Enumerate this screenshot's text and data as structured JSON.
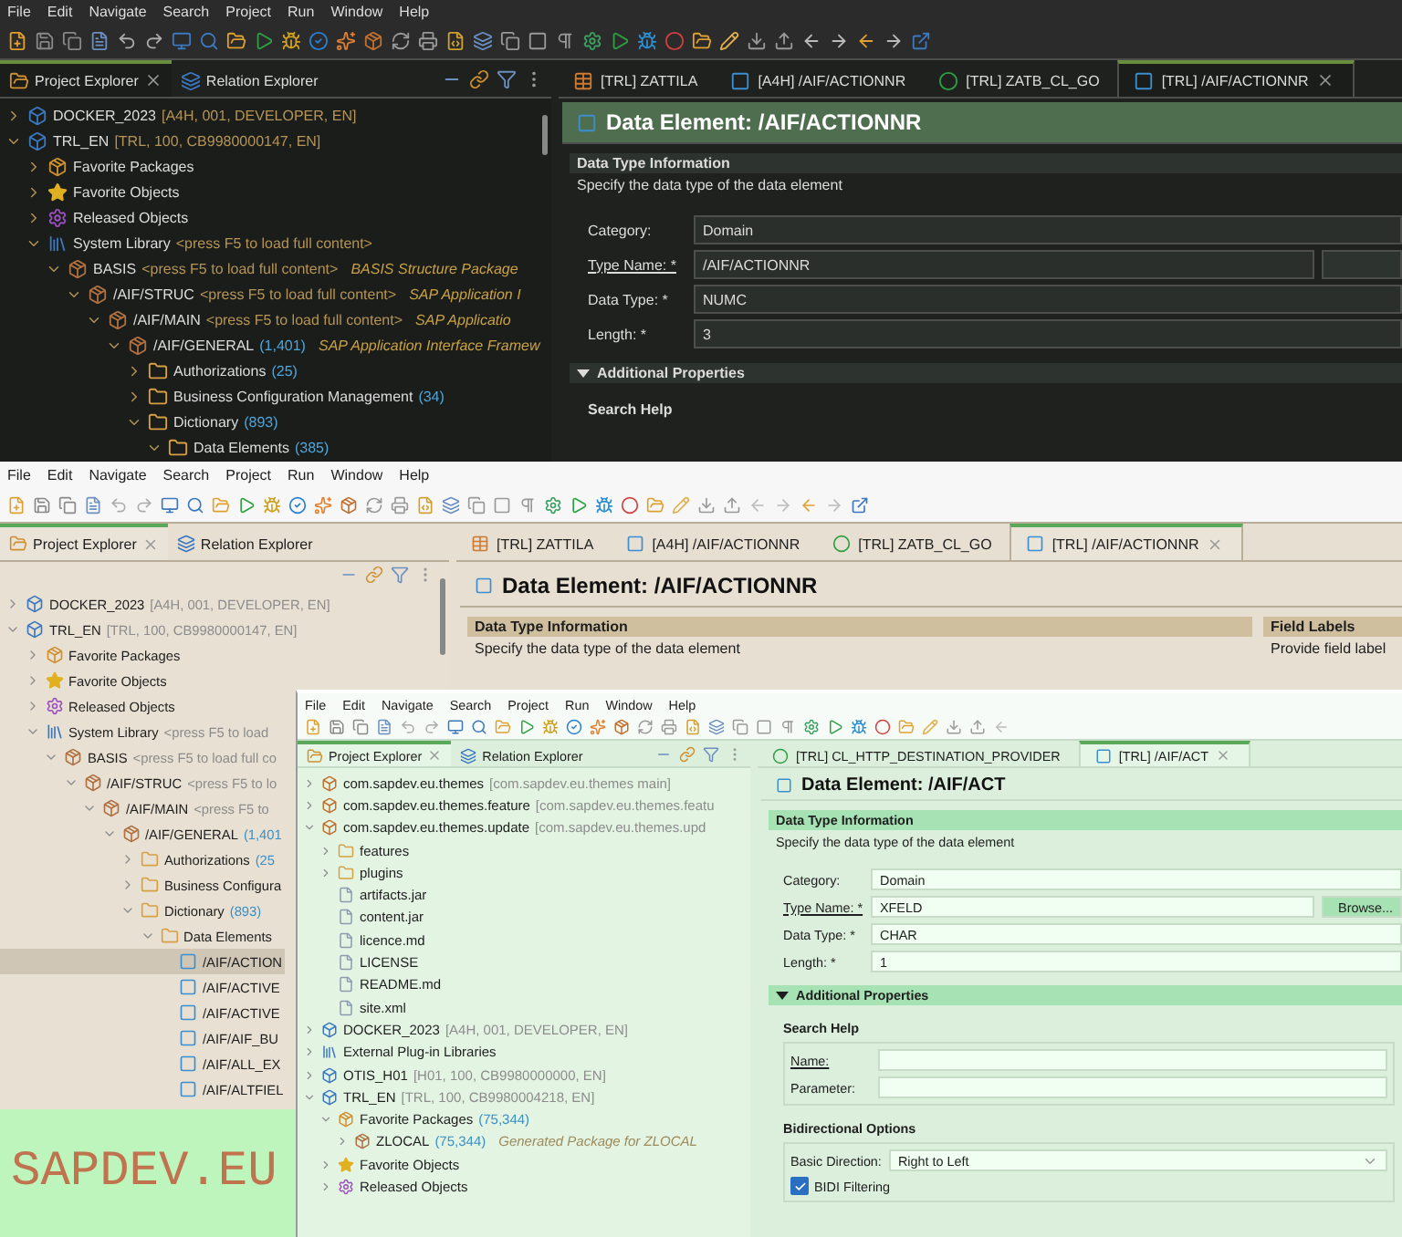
{
  "windows": [
    {
      "kind": "dark",
      "menu": [
        "File",
        "Edit",
        "Navigate",
        "Search",
        "Project",
        "Run",
        "Window",
        "Help"
      ],
      "views": [
        {
          "label": "Project Explorer",
          "selected": true
        },
        {
          "label": "Relation Explorer",
          "selected": false
        }
      ],
      "tree": [
        {
          "kind": "project",
          "label": "DOCKER_2023",
          "decoration": "[A4H, 001, DEVELOPER, EN]",
          "expanded": false
        },
        {
          "kind": "project",
          "label": "TRL_EN",
          "decoration": "[TRL, 100, CB9980000147, EN]",
          "expanded": true,
          "children": [
            {
              "kind": "favorites",
              "label": "Favorite Packages",
              "expanded": false
            },
            {
              "kind": "star",
              "label": "Favorite Objects",
              "expanded": false
            },
            {
              "kind": "released",
              "label": "Released Objects",
              "expanded": false
            },
            {
              "kind": "library",
              "label": "System Library",
              "decoration": "<press F5 to load full content>",
              "expanded": true,
              "children": [
                {
                  "kind": "package",
                  "label": "BASIS",
                  "decoration": "<press F5 to load full content>",
                  "note": "BASIS Structure Package",
                  "expanded": true,
                  "children": [
                    {
                      "kind": "package",
                      "label": "/AIF/STRUC",
                      "decoration": "<press F5 to load full content>",
                      "note": "SAP Application I",
                      "expanded": true,
                      "children": [
                        {
                          "kind": "package",
                          "label": "/AIF/MAIN",
                          "decoration": "<press F5 to load full content>",
                          "note": "SAP Applicatio",
                          "expanded": true,
                          "children": [
                            {
                              "kind": "package",
                              "label": "/AIF/GENERAL",
                              "count": "(1,401)",
                              "note": "SAP Application Interface Framew",
                              "expanded": true,
                              "children": [
                                {
                                  "kind": "group",
                                  "label": "Authorizations",
                                  "count": "(25)",
                                  "expanded": false
                                },
                                {
                                  "kind": "group",
                                  "label": "Business Configuration Management",
                                  "count": "(34)",
                                  "expanded": false
                                },
                                {
                                  "kind": "group",
                                  "label": "Dictionary",
                                  "count": "(893)",
                                  "expanded": true,
                                  "children": [
                                    {
                                      "kind": "folder",
                                      "label": "Data Elements",
                                      "count": "(385)",
                                      "expanded": true
                                    }
                                  ]
                                }
                              ]
                            }
                          ]
                        }
                      ]
                    }
                  ]
                }
              ]
            }
          ]
        }
      ],
      "editor_tabs": [
        {
          "kind": "table",
          "label": "[TRL] ZATTILA",
          "selected": false
        },
        {
          "kind": "element",
          "label": "[A4H] /AIF/ACTIONNR",
          "selected": false
        },
        {
          "kind": "class",
          "label": "[TRL] ZATB_CL_GO",
          "selected": false
        },
        {
          "kind": "element",
          "label": "[TRL] /AIF/ACTIONNR",
          "selected": true
        }
      ],
      "editor": {
        "title": "Data Element: /AIF/ACTIONNR",
        "sections": [
          {
            "title": "Data Type Information",
            "description": "Specify the data type of the data element",
            "fields": [
              {
                "kind": "text",
                "label": "Category:",
                "value": "Domain"
              },
              {
                "kind": "text",
                "label": "Type Name: *",
                "value": "/AIF/ACTIONNR",
                "link": true,
                "browse": true
              },
              {
                "kind": "text",
                "label": "Data Type: *",
                "value": "NUMC"
              },
              {
                "kind": "text",
                "label": "Length: *",
                "value": "3"
              }
            ]
          },
          {
            "title": "Additional Properties",
            "expanded": true,
            "groups": [
              {
                "title": "Search Help"
              }
            ]
          }
        ]
      }
    },
    {
      "kind": "classic",
      "menu": [
        "File",
        "Edit",
        "Navigate",
        "Search",
        "Project",
        "Run",
        "Window",
        "Help"
      ],
      "views": [
        {
          "label": "Project Explorer",
          "selected": true
        },
        {
          "label": "Relation Explorer",
          "selected": false
        }
      ],
      "tree": [
        {
          "kind": "project",
          "label": "DOCKER_2023",
          "decoration": "[A4H, 001, DEVELOPER, EN]",
          "expanded": false,
          "selected": false
        },
        {
          "kind": "project",
          "label": "TRL_EN",
          "decoration": "[TRL, 100, CB9980000147, EN]",
          "expanded": true,
          "selected": false,
          "children": [
            {
              "kind": "favorites",
              "label": "Favorite Packages",
              "expanded": false,
              "selected": false
            },
            {
              "kind": "star",
              "label": "Favorite Objects",
              "expanded": false,
              "selected": false
            },
            {
              "kind": "released",
              "label": "Released Objects",
              "expanded": false,
              "selected": false
            },
            {
              "kind": "library",
              "label": "System Library",
              "decoration": "<press F5 to load",
              "expanded": true,
              "selected": false,
              "children": [
                {
                  "kind": "package",
                  "label": "BASIS",
                  "decoration": "<press F5 to load full co",
                  "expanded": true,
                  "selected": false,
                  "children": [
                    {
                      "kind": "package",
                      "label": "/AIF/STRUC",
                      "decoration": "<press F5 to lo",
                      "expanded": true,
                      "selected": false,
                      "children": [
                        {
                          "kind": "package",
                          "label": "/AIF/MAIN",
                          "decoration": "<press F5 to",
                          "expanded": true,
                          "selected": false,
                          "children": [
                            {
                              "kind": "package",
                              "label": "/AIF/GENERAL",
                              "count": "(1,401",
                              "expanded": true,
                              "selected": false,
                              "children": [
                                {
                                  "kind": "group",
                                  "label": "Authorizations",
                                  "count": "(25",
                                  "expanded": false,
                                  "selected": false
                                },
                                {
                                  "kind": "group",
                                  "label": "Business Configura",
                                  "expanded": false,
                                  "selected": false
                                },
                                {
                                  "kind": "group",
                                  "label": "Dictionary",
                                  "count": "(893)",
                                  "expanded": true,
                                  "selected": false,
                                  "children": [
                                    {
                                      "kind": "folder",
                                      "label": "Data Elements",
                                      "expanded": true,
                                      "selected": false,
                                      "children": [
                                        {
                                          "kind": "element",
                                          "label": "/AIF/ACTION",
                                          "selected": true
                                        },
                                        {
                                          "kind": "element",
                                          "label": "/AIF/ACTIVE",
                                          "selected": false
                                        },
                                        {
                                          "kind": "element",
                                          "label": "/AIF/ACTIVE",
                                          "selected": false
                                        },
                                        {
                                          "kind": "element",
                                          "label": "/AIF/AIF_BU",
                                          "selected": false
                                        },
                                        {
                                          "kind": "element",
                                          "label": "/AIF/ALL_EX",
                                          "selected": false
                                        },
                                        {
                                          "kind": "element",
                                          "label": "/AIF/ALTFIEL",
                                          "selected": false
                                        }
                                      ]
                                    }
                                  ]
                                }
                              ]
                            }
                          ]
                        }
                      ]
                    }
                  ]
                }
              ]
            }
          ]
        }
      ],
      "editor_tabs": [
        {
          "kind": "table",
          "label": "[TRL] ZATTILA",
          "selected": false
        },
        {
          "kind": "element",
          "label": "[A4H] /AIF/ACTIONNR",
          "selected": false
        },
        {
          "kind": "class",
          "label": "[TRL] ZATB_CL_GO",
          "selected": false
        },
        {
          "kind": "element",
          "label": "[TRL] /AIF/ACTIONNR",
          "selected": true
        }
      ],
      "editor": {
        "title": "Data Element: /AIF/ACTIONNR",
        "sections": [
          {
            "title": "Data Type Information",
            "description": "Specify the data type of the data element"
          }
        ],
        "side_section": {
          "title": "Field Labels",
          "description": "Provide field label"
        }
      }
    },
    {
      "kind": "green",
      "menu": [
        "File",
        "Edit",
        "Navigate",
        "Search",
        "Project",
        "Run",
        "Window",
        "Help"
      ],
      "views": [
        {
          "label": "Project Explorer",
          "selected": true
        },
        {
          "label": "Relation Explorer",
          "selected": false
        }
      ],
      "tree": [
        {
          "kind": "plugin",
          "label": "com.sapdev.eu.themes",
          "decoration": "[com.sapdev.eu.themes main]",
          "expanded": false
        },
        {
          "kind": "plugin",
          "label": "com.sapdev.eu.themes.feature",
          "decoration": "[com.sapdev.eu.themes.featu",
          "expanded": false
        },
        {
          "kind": "plugin",
          "label": "com.sapdev.eu.themes.update",
          "decoration": "[com.sapdev.eu.themes.upd",
          "expanded": true,
          "children": [
            {
              "kind": "folder",
              "label": "features",
              "expanded": false
            },
            {
              "kind": "folder",
              "label": "plugins",
              "expanded": false
            },
            {
              "kind": "file",
              "label": "artifacts.jar"
            },
            {
              "kind": "file",
              "label": "content.jar"
            },
            {
              "kind": "file",
              "label": "licence.md"
            },
            {
              "kind": "file",
              "label": "LICENSE"
            },
            {
              "kind": "file",
              "label": "README.md"
            },
            {
              "kind": "file",
              "label": "site.xml"
            }
          ]
        },
        {
          "kind": "project",
          "label": "DOCKER_2023",
          "decoration": "[A4H, 001, DEVELOPER, EN]",
          "expanded": false
        },
        {
          "kind": "library",
          "label": "External Plug-in Libraries",
          "expanded": false
        },
        {
          "kind": "project",
          "label": "OTIS_H01",
          "decoration": "[H01, 100, CB9980000000, EN]",
          "expanded": false
        },
        {
          "kind": "project",
          "label": "TRL_EN",
          "decoration": "[TRL, 100, CB9980004218, EN]",
          "expanded": true,
          "children": [
            {
              "kind": "favorites",
              "label": "Favorite Packages",
              "count": "(75,344)",
              "expanded": true,
              "children": [
                {
                  "kind": "package",
                  "label": "ZLOCAL",
                  "count": "(75,344)",
                  "note": "Generated Package for ZLOCAL",
                  "expanded": false
                }
              ]
            },
            {
              "kind": "star",
              "label": "Favorite Objects",
              "expanded": false
            },
            {
              "kind": "released",
              "label": "Released Objects",
              "expanded": false
            }
          ]
        }
      ],
      "editor_tabs": [
        {
          "kind": "class",
          "label": "[TRL] CL_HTTP_DESTINATION_PROVIDER",
          "selected": false
        },
        {
          "kind": "element",
          "label": "[TRL] /AIF/ACT",
          "selected": true
        }
      ],
      "editor": {
        "title": "Data Element: /AIF/ACT",
        "sections": [
          {
            "title": "Data Type Information",
            "description": "Specify the data type of the data element",
            "fields": [
              {
                "kind": "text",
                "label": "Category:",
                "value": "Domain"
              },
              {
                "kind": "text",
                "label": "Type Name: *",
                "value": "XFELD",
                "link": true,
                "browse": true,
                "browse_label": "Browse..."
              },
              {
                "kind": "text",
                "label": "Data Type: *",
                "value": "CHAR"
              },
              {
                "kind": "text",
                "label": "Length: *",
                "value": "1"
              }
            ]
          },
          {
            "title": "Additional Properties",
            "expanded": true,
            "groups": [
              {
                "title": "Search Help",
                "fields": [
                  {
                    "kind": "text",
                    "label": "Name:",
                    "link": true
                  },
                  {
                    "kind": "text",
                    "label": "Parameter:"
                  }
                ]
              },
              {
                "title": "Bidirectional Options",
                "fields": [
                  {
                    "kind": "select",
                    "label": "Basic Direction:",
                    "value": "Right to Left"
                  }
                ],
                "checkbox": {
                  "label": "BIDI Filtering",
                  "checked": true
                }
              }
            ]
          }
        ]
      }
    }
  ],
  "banner": {
    "text": "SAPDEV.EU"
  }
}
